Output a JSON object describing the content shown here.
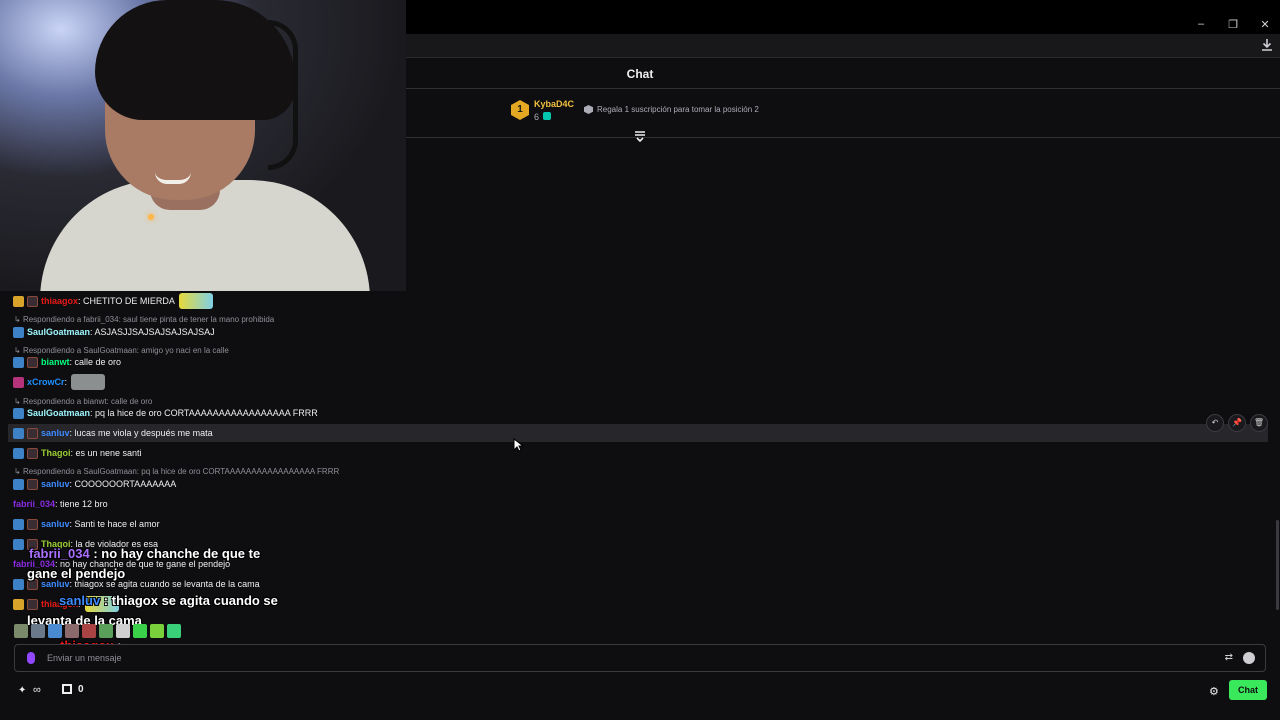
{
  "window": {
    "controls": [
      "–",
      "❐",
      "✕"
    ]
  },
  "header": {
    "title": "Chat"
  },
  "leaderboard": {
    "rank": "1",
    "user": "KybaD4C",
    "count": "6",
    "hint": "Regala 1 suscripción para tomar la posición 2"
  },
  "messages": [
    {
      "user": "thiaagox",
      "user_color": "#e91916",
      "text": ": CHETITO DE MIERDA"
    },
    {
      "reply": "Respondiendo a fabrii_034: saul tiene pinta de tener la mano prohibida"
    },
    {
      "user": "SaulGoatmaan",
      "user_color": "#9ef7ff",
      "text": ": ASJASJJSAJSAJSAJSAJSAJ"
    },
    {
      "reply": "Respondiendo a SaulGoatmaan: amigo yo naci en la calle"
    },
    {
      "user": "bianwt",
      "user_color": "#00ff7f",
      "text": ": calle de oro"
    },
    {
      "user": "xCrowCr",
      "user_color": "#1e90ff",
      "text": ":"
    },
    {
      "reply": "Respondiendo a bianwt: calle de oro"
    },
    {
      "user": "SaulGoatmaan",
      "user_color": "#9ef7ff",
      "text": ": pq la hice de oro CORTAAAAAAAAAAAAAAAAA FRRR"
    },
    {
      "user": "sanluv",
      "user_color": "#3d8bff",
      "text": ": lucas me viola y después me mata"
    },
    {
      "user": "Thagoi",
      "user_color": "#9acd32",
      "text": ": es un nene santi"
    },
    {
      "reply": "Respondiendo a SaulGoatmaan: pq la hice de oro CORTAAAAAAAAAAAAAAAAA FRRR"
    },
    {
      "user": "sanluv",
      "user_color": "#3d8bff",
      "text": ": COOOOOORTAAAAAAA"
    },
    {
      "user": "fabrii_034",
      "user_color": "#8a2be2",
      "text": ": tiene 12 bro"
    },
    {
      "user": "sanluv",
      "user_color": "#3d8bff",
      "text": ": Santi te hace el amor"
    },
    {
      "user": "Thagoi",
      "user_color": "#9acd32",
      "text": ": la de violador es esa"
    },
    {
      "user": "fabrii_034",
      "user_color": "#8a2be2",
      "text": ": no hay chanche de que te gane el pendejo"
    },
    {
      "user": "sanluv",
      "user_color": "#3d8bff",
      "text": ": thiagox se agita cuando se levanta de la cama"
    },
    {
      "user": "thiaagox",
      "user_color": "#e91916",
      "text": ":"
    }
  ],
  "overlay": {
    "line1_user": "fabrii_034",
    "line1_text": " : no hay chanche de que te",
    "line1_cont": "gane el pendejo",
    "line2_user": "sanluv",
    "line2_text": " : thiagox se agita cuando se",
    "line2_cont": "levanta de la cama",
    "line3_user": "thiaagox",
    "line3_text": " :"
  },
  "message_actions": [
    "↶",
    "📌",
    "🗑"
  ],
  "input": {
    "placeholder": "Enviar un mensaje"
  },
  "bottom": {
    "infinity": "∞",
    "shop_count": "0",
    "chat_button": "Chat"
  },
  "colors": {
    "accent_green": "#3ae85c",
    "purple": "#9147ff"
  },
  "icons": [
    "download-icon",
    "expand-icon",
    "mic-icon",
    "translate-icon",
    "emoji-icon",
    "points-icon",
    "shop-icon",
    "settings-icon"
  ]
}
